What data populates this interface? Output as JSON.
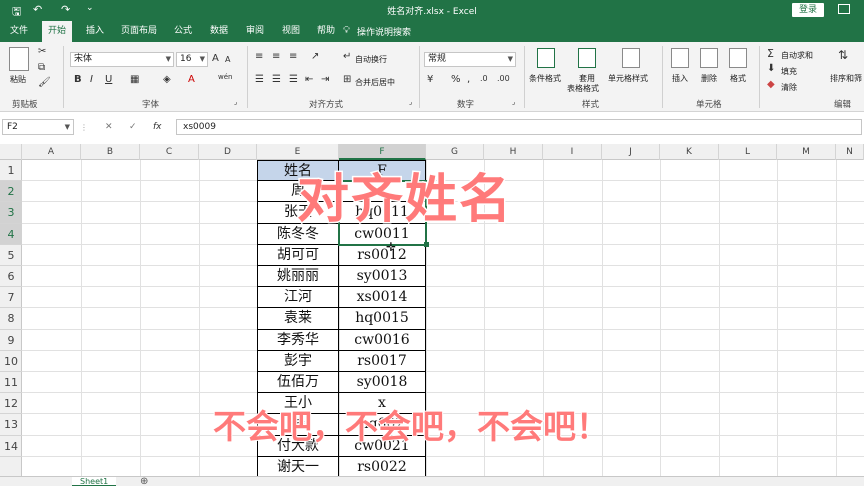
{
  "app": {
    "title": "姓名对齐.xlsx  -  Excel",
    "login": "登录",
    "quick_access": {
      "save": "🖫",
      "undo": "↶",
      "redo": "↷",
      "more": "⌄"
    }
  },
  "tabs": [
    {
      "label": "文件",
      "active": false
    },
    {
      "label": "开始",
      "active": true
    },
    {
      "label": "插入",
      "active": false
    },
    {
      "label": "页面布局",
      "active": false
    },
    {
      "label": "公式",
      "active": false
    },
    {
      "label": "数据",
      "active": false
    },
    {
      "label": "审阅",
      "active": false
    },
    {
      "label": "视图",
      "active": false
    },
    {
      "label": "帮助",
      "active": false
    }
  ],
  "tell_me": "操作说明搜索",
  "ribbon": {
    "clipboard": {
      "label": "剪贴板",
      "paste": "粘贴"
    },
    "font": {
      "label": "字体",
      "name": "宋体",
      "size": "16",
      "bold": "B",
      "italic": "I",
      "underline": "U",
      "grow": "A",
      "shrink": "A",
      "wen": "wén"
    },
    "alignment": {
      "label": "对齐方式",
      "wrap": "自动换行",
      "merge": "合并后居中"
    },
    "number": {
      "label": "数字",
      "format": "常规",
      "percent": "%",
      "comma": ","
    },
    "styles": {
      "label": "样式",
      "conditional": "条件格式",
      "table": "套用\n表格格式",
      "cell_styles": "单元格样式"
    },
    "cells": {
      "label": "单元格",
      "insert": "插入",
      "delete": "删除",
      "format": "格式"
    },
    "editing": {
      "label": "编辑",
      "autosum": "自动求和",
      "fill": "填充",
      "clear": "清除",
      "sort": "排序和筛"
    }
  },
  "formula_bar": {
    "name_box": "F2",
    "cancel": "✕",
    "enter": "✓",
    "fx": "fx",
    "value": "xs0009"
  },
  "columns": [
    "A",
    "B",
    "C",
    "D",
    "E",
    "F",
    "G",
    "H",
    "I",
    "J",
    "K",
    "L",
    "M",
    "N"
  ],
  "rows": [
    "1",
    "2",
    "3",
    "4",
    "5",
    "6",
    "7",
    "8",
    "9",
    "10",
    "11",
    "12",
    "13",
    "14"
  ],
  "table": {
    "header": [
      "姓名",
      "F"
    ],
    "names": [
      "周",
      "张天",
      "陈冬冬",
      "胡可可",
      "姚丽丽",
      "江河",
      "袁莱",
      "李秀华",
      "彭宇",
      "伍佰万",
      "王小",
      "钱",
      "付大款",
      "谢天一"
    ],
    "codes": [
      "x",
      "hq0011",
      "cw0011",
      "rs0012",
      "sy0013",
      "xs0014",
      "hq0015",
      "cw0016",
      "rs0017",
      "sy0018",
      "x",
      "hq002",
      "cw0021",
      "rs0022"
    ]
  },
  "sheet_tab": "Sheet1",
  "overlay": {
    "title": "对齐姓名",
    "subtitle": "不会吧，不会吧，不会吧！"
  },
  "colors": {
    "accent": "#217346",
    "overlay_text": "#ff7a7a",
    "header_fill": "#c5d5ea"
  }
}
